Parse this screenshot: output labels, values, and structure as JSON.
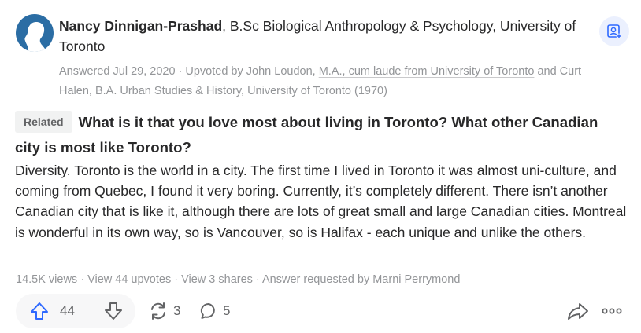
{
  "author": {
    "name": "Nancy Dinnigan-Prashad",
    "credential": ", B.Sc Biological Anthropology & Psychology, University of Toronto"
  },
  "meta": {
    "answered": "Answered Jul 29, 2020 · Upvoted by John Loudon, ",
    "upvoter1_credential": "M.A., cum laude from University of Toronto",
    "and": " and Curt Halen, ",
    "upvoter2_credential": "B.A. Urban Studies & History, University of Toronto (1970)"
  },
  "related_label": "Related",
  "question": "What is it that you love most about living in Toronto? What other Canadian city is most like Toronto?",
  "answer": "Diversity. Toronto is the world in a city. The first time I lived in Toronto it was almost uni-culture, and coming from Quebec, I found it very boring. Currently, it’s completely different. There isn’t another Canadian city that is like it, although there are lots of great small and large Canadian cities. Montreal is wonderful in its own way, so is Vancouver, so is Halifax - each unique and unlike the others.",
  "stats": "14.5K views · View 44 upvotes · View 3 shares · Answer requested by Marni Perrymond",
  "actions": {
    "upvotes": "44",
    "shares": "3",
    "comments": "5"
  },
  "icons": {
    "avatar": "user-avatar",
    "corner": "add-to-space-icon",
    "upvote": "upvote-arrow-icon",
    "downvote": "downvote-arrow-icon",
    "share_cycle": "reshare-icon",
    "comment": "comment-bubble-icon",
    "share": "share-arrow-icon",
    "more": "more-dots-icon"
  },
  "colors": {
    "accent": "#2e69ff",
    "muted": "#939598",
    "text": "#282829",
    "avatar_bg": "#2b6da4"
  }
}
